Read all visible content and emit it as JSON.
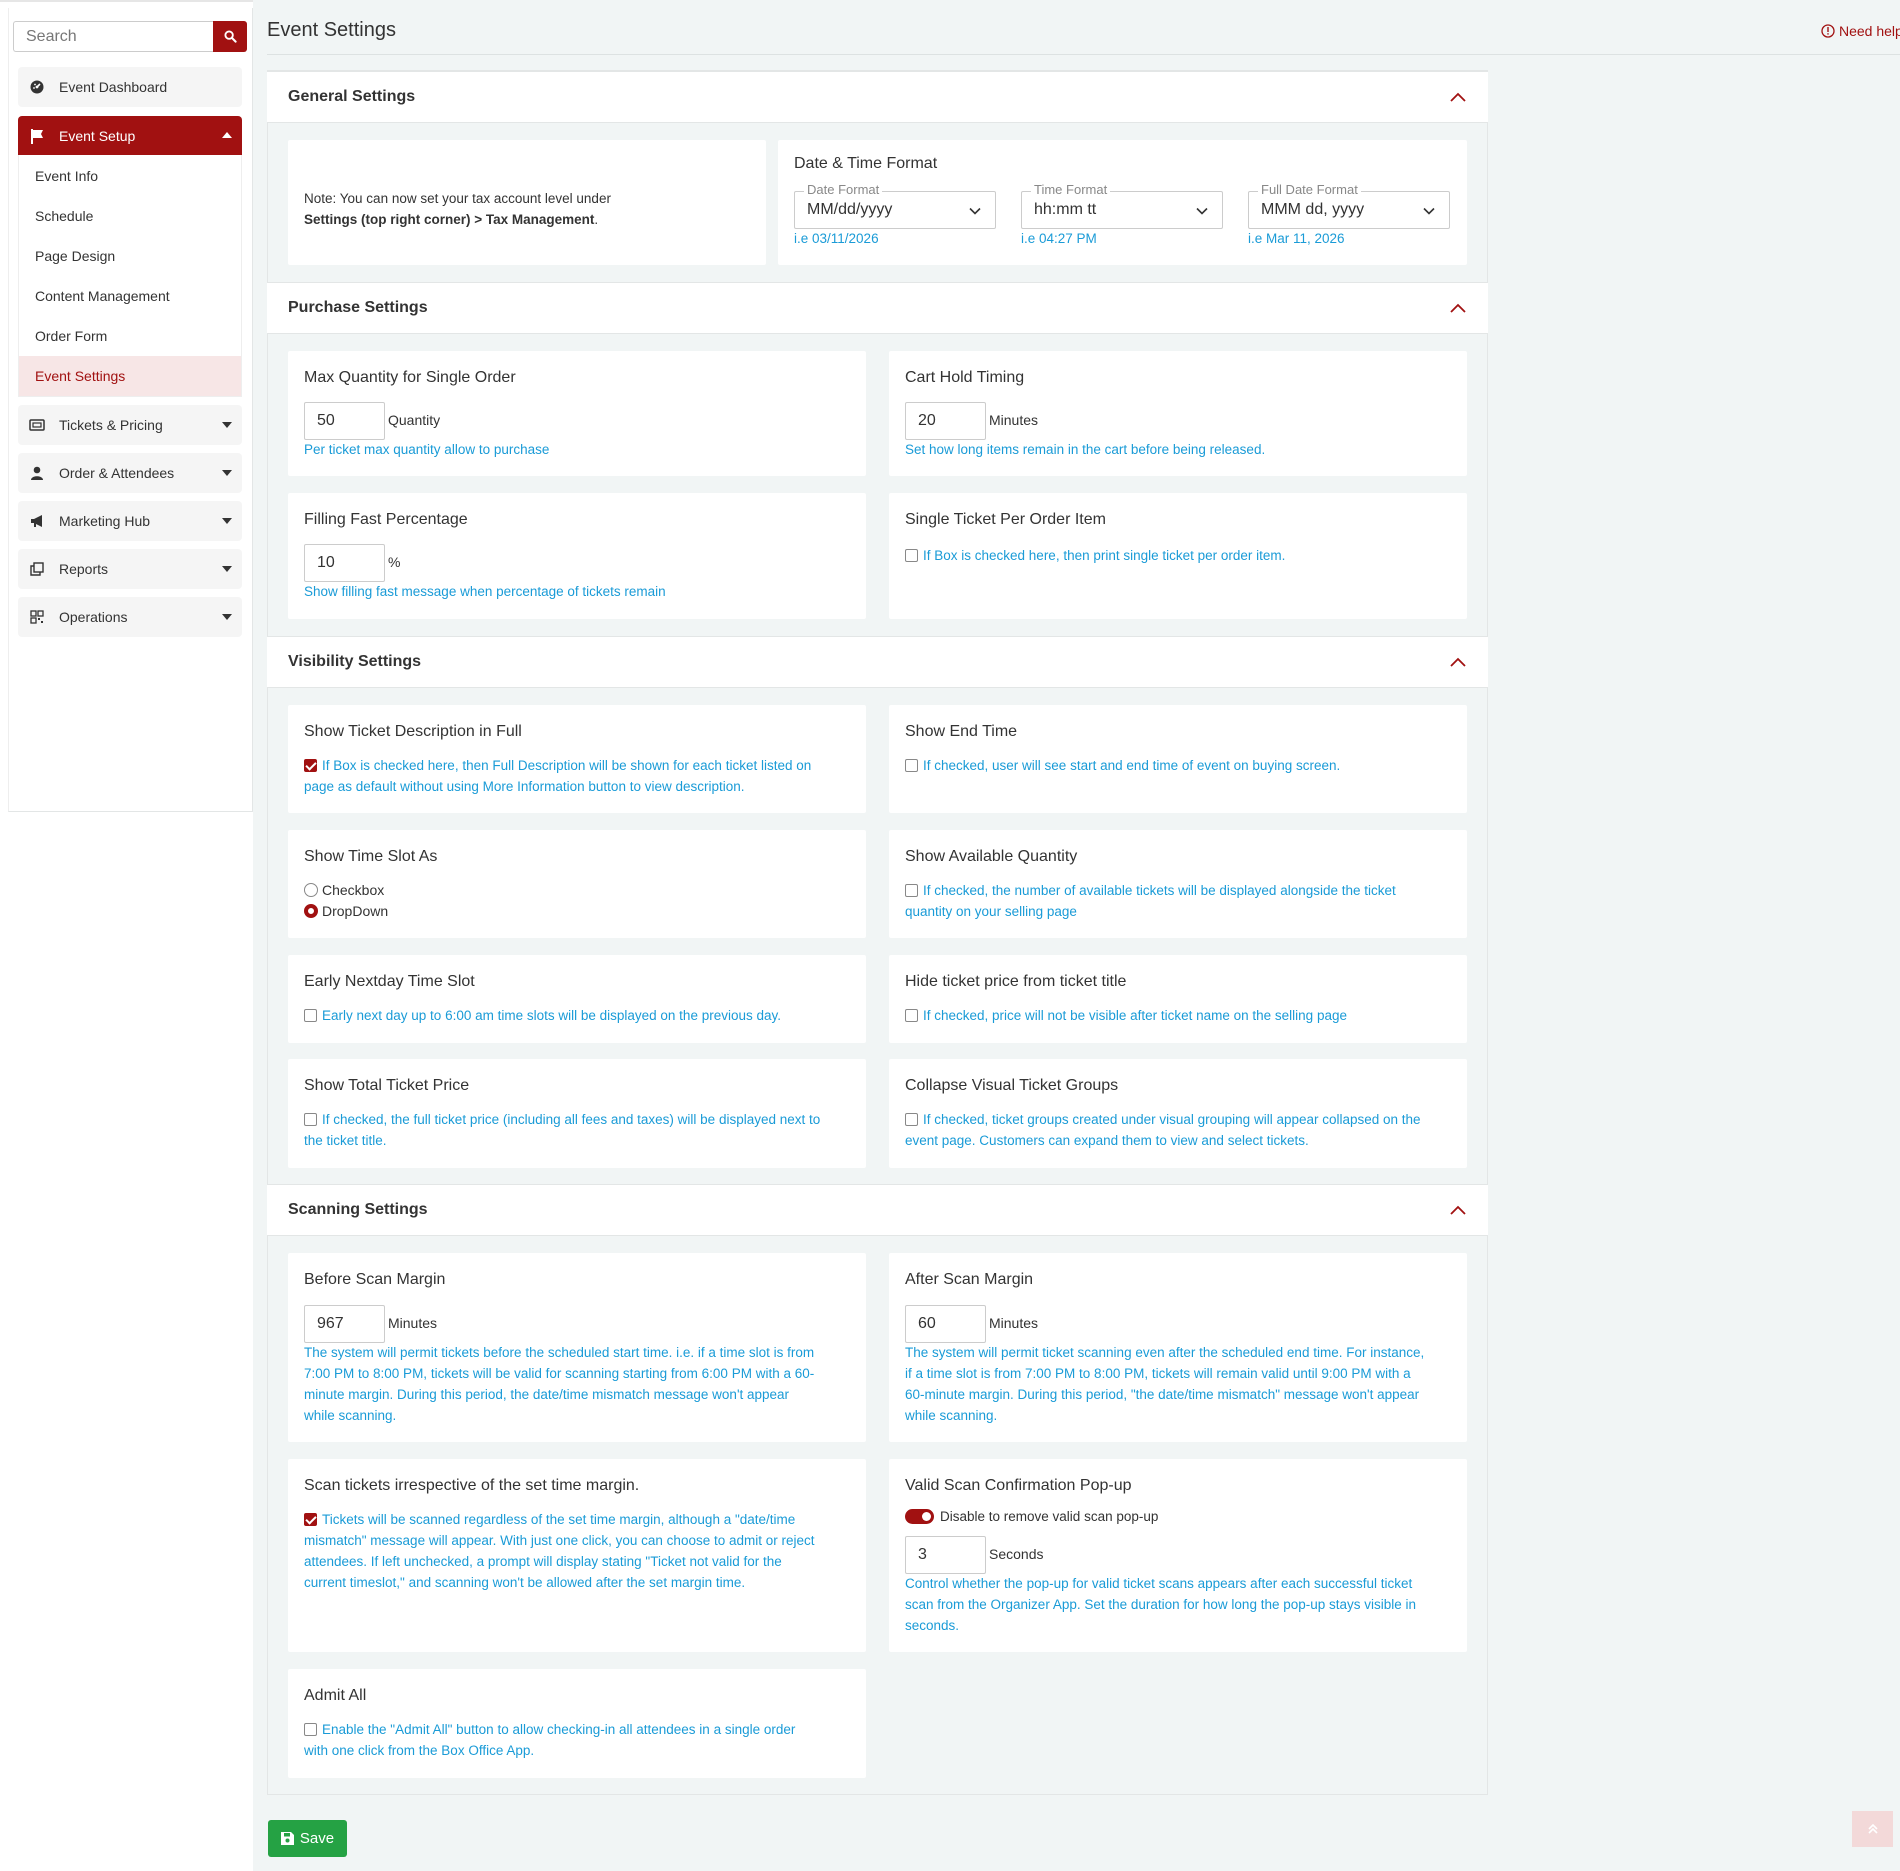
{
  "search": {
    "placeholder": "Search"
  },
  "sidebar": {
    "items": [
      {
        "label": "Event Dashboard",
        "icon": "dashboard-icon"
      },
      {
        "label": "Event Setup",
        "icon": "flag-icon"
      },
      {
        "label": "Tickets & Pricing",
        "icon": "ticket-icon"
      },
      {
        "label": "Order & Attendees",
        "icon": "user-icon"
      },
      {
        "label": "Marketing Hub",
        "icon": "megaphone-icon"
      },
      {
        "label": "Reports",
        "icon": "copy-icon"
      },
      {
        "label": "Operations",
        "icon": "qr-icon"
      }
    ],
    "subitems": [
      {
        "label": "Event Info"
      },
      {
        "label": "Schedule"
      },
      {
        "label": "Page Design"
      },
      {
        "label": "Content Management"
      },
      {
        "label": "Order Form"
      },
      {
        "label": "Event Settings"
      }
    ]
  },
  "header": {
    "title": "Event Settings",
    "help": "Need help"
  },
  "general": {
    "title": "General Settings",
    "note_line1": "Note: You can now set your tax account level under",
    "note_line2_bold": "Settings (top right corner) > Tax Management",
    "note_line2_end": ".",
    "datetime_title": "Date & Time Format",
    "date_format": {
      "legend": "Date Format",
      "value": "MM/dd/yyyy",
      "example": "i.e 03/11/2026"
    },
    "time_format": {
      "legend": "Time Format",
      "value": "hh:mm tt",
      "example": "i.e 04:27 PM"
    },
    "full_date_format": {
      "legend": "Full Date Format",
      "value": "MMM dd, yyyy",
      "example": "i.e Mar 11, 2026"
    }
  },
  "purchase": {
    "title": "Purchase Settings",
    "max_qty": {
      "title": "Max Quantity for Single Order",
      "value": "50",
      "unit": "Quantity",
      "help": "Per ticket max quantity allow to purchase"
    },
    "cart_hold": {
      "title": "Cart Hold Timing",
      "value": "20",
      "unit": "Minutes",
      "help": "Set how long items remain in the cart before being released."
    },
    "filling_fast": {
      "title": "Filling Fast Percentage",
      "value": "10",
      "unit": "%",
      "help": "Show filling fast message when percentage of tickets remain"
    },
    "single_ticket": {
      "title": "Single Ticket Per Order Item",
      "help": "If Box is checked here, then print single ticket per order item."
    }
  },
  "visibility": {
    "title": "Visibility Settings",
    "desc_full": {
      "title": "Show Ticket Description in Full",
      "help_line1": "If Box is checked here, then Full Description will be shown for each ticket listed on",
      "help_line2": "page as default without using More Information button to view description."
    },
    "end_time": {
      "title": "Show End Time",
      "help": "If checked, user will see start and end time of event on buying screen."
    },
    "time_slot": {
      "title": "Show Time Slot As",
      "option1": "Checkbox",
      "option2": "DropDown"
    },
    "avail_qty": {
      "title": "Show Available Quantity",
      "help_line1": "If checked, the number of available tickets will be displayed alongside the ticket",
      "help_line2": "quantity on your selling page"
    },
    "early_nextday": {
      "title": "Early Nextday Time Slot",
      "help": "Early next day up to 6:00 am time slots will be displayed on the previous day."
    },
    "hide_price": {
      "title": "Hide ticket price from ticket title",
      "help": "If checked, price will not be visible after ticket name on the selling page"
    },
    "total_price": {
      "title": "Show Total Ticket Price",
      "help_line1": "If checked, the full ticket price (including all fees and taxes) will be displayed next to",
      "help_line2": "the ticket title."
    },
    "collapse_groups": {
      "title": "Collapse Visual Ticket Groups",
      "help_line1": "If checked, ticket groups created under visual grouping will appear collapsed on the",
      "help_line2": "event page. Customers can expand them to view and select tickets."
    }
  },
  "scanning": {
    "title": "Scanning Settings",
    "before": {
      "title": "Before Scan Margin",
      "value": "967",
      "unit": "Minutes",
      "help": [
        "The system will permit tickets before the scheduled start time. i.e. if a time slot is from",
        "7:00 PM to 8:00 PM, tickets will be valid for scanning starting from 6:00 PM with a 60-",
        "minute margin. During this period, the date/time mismatch message won't appear",
        "while scanning."
      ]
    },
    "after": {
      "title": "After Scan Margin",
      "value": "60",
      "unit": "Minutes",
      "help": [
        "The system will permit ticket scanning even after the scheduled end time. For instance,",
        "if a time slot is from 7:00 PM to 8:00 PM, tickets will remain valid until 9:00 PM with a",
        "60-minute margin. During this period, \"the date/time mismatch\" message won't appear",
        "while scanning."
      ]
    },
    "irrespective": {
      "title": "Scan tickets irrespective of the set time margin.",
      "help": [
        "Tickets will be scanned regardless of the set time margin, although a \"date/time",
        "mismatch\" message will appear. With just one click, you can choose to admit or reject",
        "attendees. If left unchecked, a prompt will display stating \"Ticket not valid for the",
        "current timeslot,\" and scanning won't be allowed after the set margin time."
      ]
    },
    "popup": {
      "title": "Valid Scan Confirmation Pop-up",
      "toggle_label": "Disable to remove valid scan pop-up",
      "value": "3",
      "unit": "Seconds",
      "help": [
        "Control whether the pop-up for valid ticket scans appears after each successful ticket",
        "scan from the Organizer App. Set the duration for how long the pop-up stays visible in",
        "seconds."
      ]
    },
    "admit_all": {
      "title": "Admit All",
      "help_line1": "Enable the \"Admit All\" button to allow checking-in all attendees in a single order",
      "help_line2": "with one click from the Box Office App."
    }
  },
  "actions": {
    "save": "Save"
  },
  "colors": {
    "brand": "#a11111",
    "help_text": "#1a9bd7",
    "save": "#25a244",
    "page_bg": "#f1f5f5"
  }
}
